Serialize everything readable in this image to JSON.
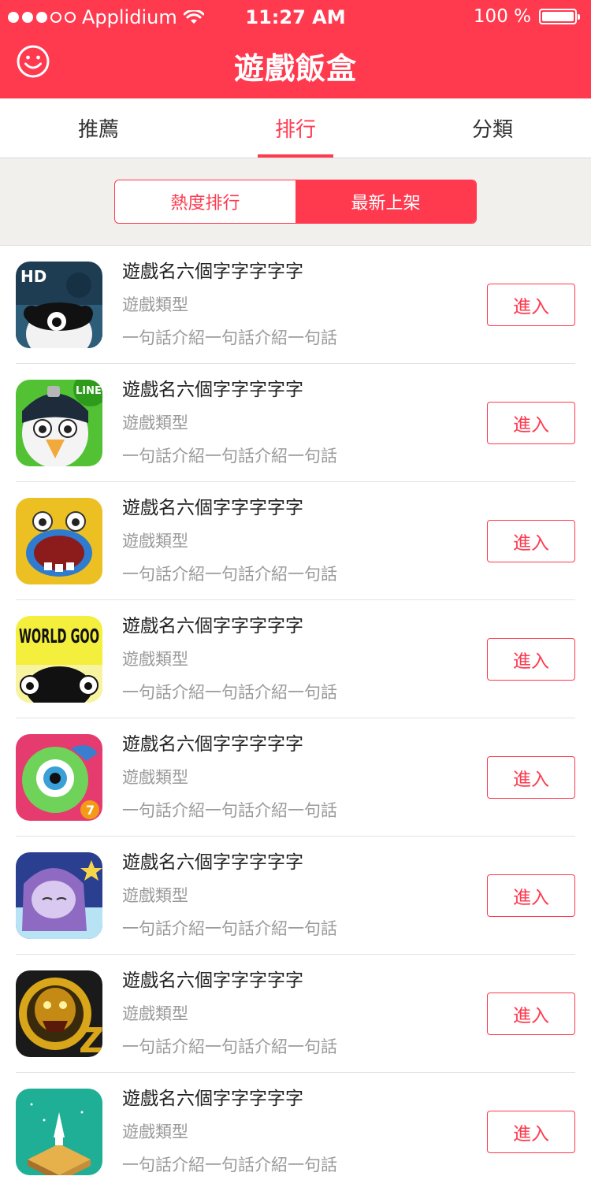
{
  "status_bar": {
    "carrier": "Applidium",
    "time": "11:27 AM",
    "battery_text": "100 %",
    "battery_level": 1.0
  },
  "nav": {
    "title": "遊戲飯盒",
    "icon": "smile-icon"
  },
  "tabs": [
    {
      "label": "推薦",
      "active": false
    },
    {
      "label": "排行",
      "active": true
    },
    {
      "label": "分類",
      "active": false
    }
  ],
  "segment": {
    "options": [
      "熱度排行",
      "最新上架"
    ],
    "selected": "最新上架"
  },
  "games": [
    {
      "name": "遊戲名六個字字字字字",
      "genre": "遊戲類型",
      "description": "一句話介紹一句話介紹一句話",
      "button": "進入",
      "icon_art": "HD"
    },
    {
      "name": "遊戲名六個字字字字字",
      "genre": "遊戲類型",
      "description": "一句話介紹一句話介紹一句話",
      "button": "進入",
      "icon_art": "LINE"
    },
    {
      "name": "遊戲名六個字字字字字",
      "genre": "遊戲類型",
      "description": "一句話介紹一句話介紹一句話",
      "button": "進入",
      "icon_art": ""
    },
    {
      "name": "遊戲名六個字字字字字",
      "genre": "遊戲類型",
      "description": "一句話介紹一句話介紹一句話",
      "button": "進入",
      "icon_art": "WORLD GOO"
    },
    {
      "name": "遊戲名六個字字字字字",
      "genre": "遊戲類型",
      "description": "一句話介紹一句話介紹一句話",
      "button": "進入",
      "icon_art": "7"
    },
    {
      "name": "遊戲名六個字字字字字",
      "genre": "遊戲類型",
      "description": "一句話介紹一句話介紹一句話",
      "button": "進入",
      "icon_art": ""
    },
    {
      "name": "遊戲名六個字字字字字",
      "genre": "遊戲類型",
      "description": "一句話介紹一句話介紹一句話",
      "button": "進入",
      "icon_art": "Z"
    },
    {
      "name": "遊戲名六個字字字字字",
      "genre": "遊戲類型",
      "description": "一句話介紹一句話介紹一句話",
      "button": "進入",
      "icon_art": ""
    }
  ],
  "colors": {
    "accent": "#ff3a4f",
    "secondary_text": "#9a9a9a",
    "segment_background": "#f2f0ed"
  }
}
